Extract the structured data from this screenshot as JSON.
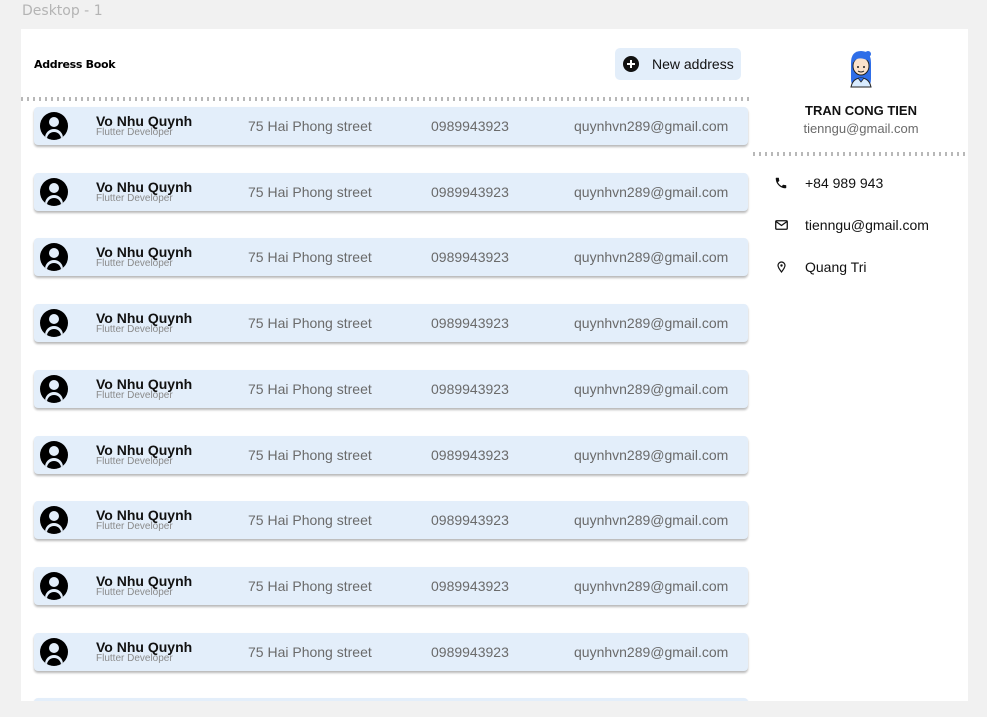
{
  "frame": {
    "label": "Desktop - 1"
  },
  "header": {
    "title": "Address Book",
    "new_address_label": "New address",
    "new_address_icon": "plus-circle-icon"
  },
  "contacts": [
    {
      "name": "Vo Nhu Quynh",
      "role": "Flutter Developer",
      "address": "75 Hai Phong street",
      "phone": "0989943923",
      "email": "quynhvn289@gmail.com"
    },
    {
      "name": "Vo Nhu Quynh",
      "role": "Flutter Developer",
      "address": "75 Hai Phong street",
      "phone": "0989943923",
      "email": "quynhvn289@gmail.com"
    },
    {
      "name": "Vo Nhu Quynh",
      "role": "Flutter Developer",
      "address": "75 Hai Phong street",
      "phone": "0989943923",
      "email": "quynhvn289@gmail.com"
    },
    {
      "name": "Vo Nhu Quynh",
      "role": "Flutter Developer",
      "address": "75 Hai Phong street",
      "phone": "0989943923",
      "email": "quynhvn289@gmail.com"
    },
    {
      "name": "Vo Nhu Quynh",
      "role": "Flutter Developer",
      "address": "75 Hai Phong street",
      "phone": "0989943923",
      "email": "quynhvn289@gmail.com"
    },
    {
      "name": "Vo Nhu Quynh",
      "role": "Flutter Developer",
      "address": "75 Hai Phong street",
      "phone": "0989943923",
      "email": "quynhvn289@gmail.com"
    },
    {
      "name": "Vo Nhu Quynh",
      "role": "Flutter Developer",
      "address": "75 Hai Phong street",
      "phone": "0989943923",
      "email": "quynhvn289@gmail.com"
    },
    {
      "name": "Vo Nhu Quynh",
      "role": "Flutter Developer",
      "address": "75 Hai Phong street",
      "phone": "0989943923",
      "email": "quynhvn289@gmail.com"
    },
    {
      "name": "Vo Nhu Quynh",
      "role": "Flutter Developer",
      "address": "75 Hai Phong street",
      "phone": "0989943923",
      "email": "quynhvn289@gmail.com"
    },
    {
      "name": "",
      "role": "",
      "address": "",
      "phone": "",
      "email": ""
    }
  ],
  "profile": {
    "name": "TRAN CONG TIEN",
    "email": "tienngu@gmail.com",
    "details": [
      {
        "icon": "phone-icon",
        "text": "+84 989 943"
      },
      {
        "icon": "mail-icon",
        "text": "tienngu@gmail.com"
      },
      {
        "icon": "location-pin-icon",
        "text": "Quang Tri"
      }
    ]
  },
  "colors": {
    "row_background": "#e3eefa",
    "accent_blue": "#2f6ee8"
  }
}
